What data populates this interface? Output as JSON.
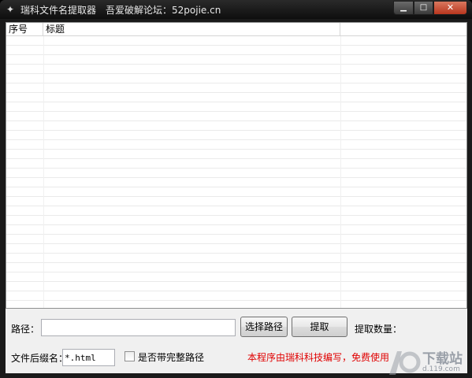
{
  "window": {
    "title": "瑞科文件名提取器",
    "subtitle": "吾爱破解论坛：52pojie.cn",
    "minimize_glyph": "▁",
    "maximize_glyph": "□",
    "close_glyph": "✕"
  },
  "list": {
    "columns": [
      "序号",
      "标题",
      ""
    ]
  },
  "form": {
    "path_label": "路径：",
    "path_value": "",
    "choose_path_button": "选择路径",
    "extract_button": "提取",
    "count_label": "提取数量：",
    "ext_label": "文件后缀名：",
    "ext_value": "*.html",
    "full_path_checkbox_label": "是否带完整路径",
    "full_path_checked": false,
    "footer_note": "本程序由瑞科科技编写，免费使用"
  },
  "watermark": {
    "text": "下载站",
    "site": "d.119.com"
  },
  "colors": {
    "titlebar": "#0e0e0e",
    "note_red": "#e00000",
    "close_red": "#c8472e"
  }
}
